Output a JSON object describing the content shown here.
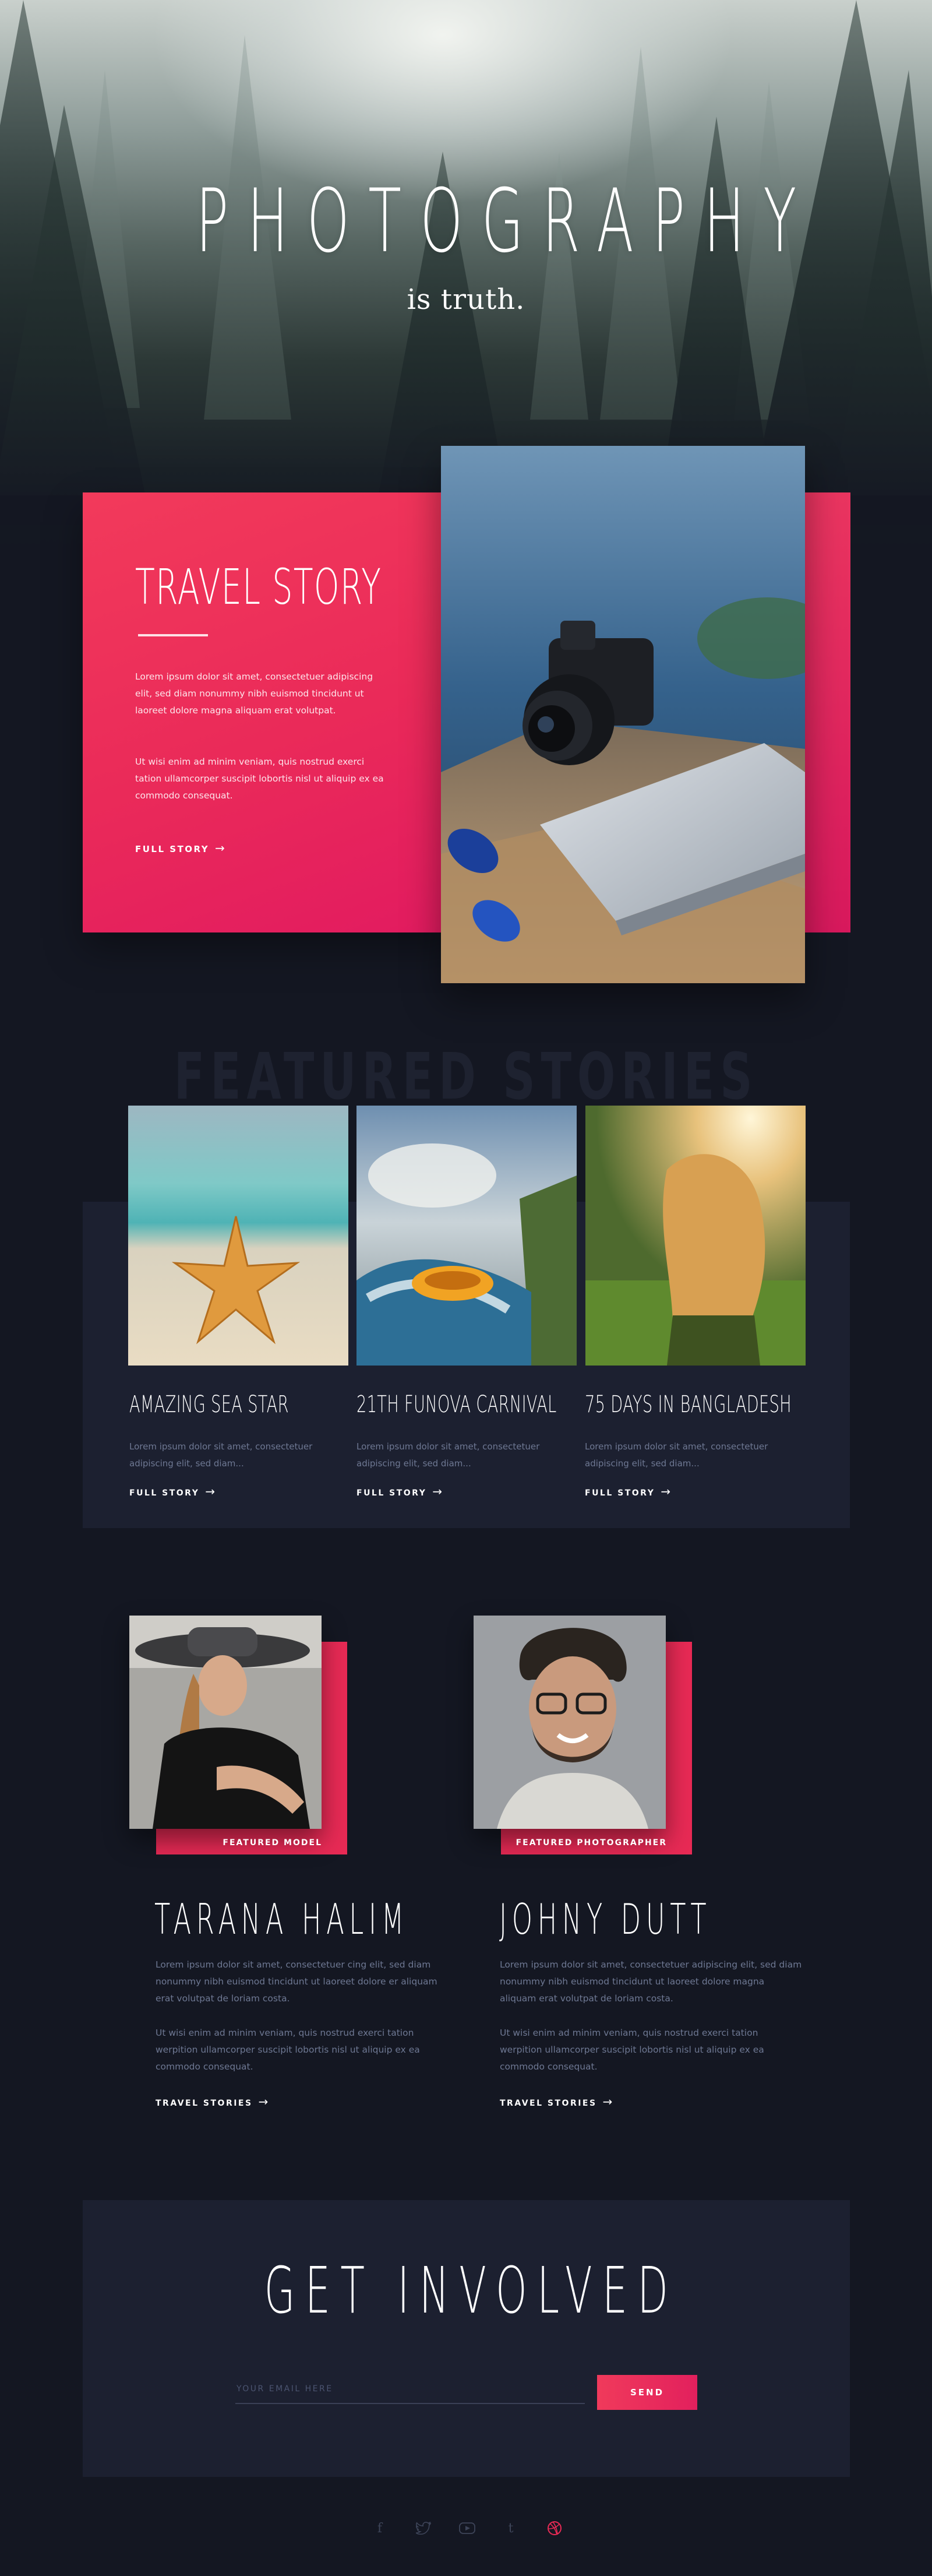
{
  "hero": {
    "title": "PHOTOGRAPHY",
    "subtitle": "is truth."
  },
  "travel": {
    "title": "TRAVEL STORY",
    "para1": "Lorem ipsum dolor sit amet, consectetuer adipiscing elit, sed diam nonummy nibh euismod tincidunt ut laoreet dolore magna aliquam erat volutpat.",
    "para2": "Ut wisi enim ad minim veniam, quis nostrud exerci tation ullamcorper suscipit lobortis nisl ut aliquip ex ea commodo consequat.",
    "link": "FULL STORY",
    "arrow": "→"
  },
  "featured": {
    "heading": "FEATURED STORIES",
    "stories": [
      {
        "title": "AMAZING SEA STAR",
        "desc": "Lorem ipsum dolor sit amet, consectetuer adipiscing elit, sed diam...",
        "link": "FULL STORY"
      },
      {
        "title": "21TH FUNOVA CARNIVAL",
        "desc": "Lorem ipsum dolor sit amet, consectetuer adipiscing elit, sed diam...",
        "link": "FULL STORY"
      },
      {
        "title": "75 DAYS IN BANGLADESH",
        "desc": "Lorem ipsum dolor sit amet, consectetuer adipiscing elit, sed diam...",
        "link": "FULL STORY"
      }
    ]
  },
  "people": [
    {
      "label": "FEATURED MODEL",
      "name": "TARANA HALIM",
      "para1": "Lorem ipsum dolor sit amet, consectetuer cing elit, sed diam nonummy nibh euismod tincidunt ut laoreet dolore er aliquam erat volutpat de loriam costa.",
      "para2": "Ut wisi enim ad minim veniam, quis nostrud exerci tation werpition ullamcorper suscipit lobortis nisl ut aliquip ex ea commodo consequat.",
      "link": "TRAVEL STORIES"
    },
    {
      "label": "FEATURED PHOTOGRAPHER",
      "name": "JOHNY DUTT",
      "para1": "Lorem ipsum dolor sit amet, consectetuer adipiscing elit, sed diam nonummy nibh euismod tincidunt ut laoreet dolore magna aliquam erat volutpat de loriam costa.",
      "para2": "Ut wisi enim ad minim veniam, quis nostrud exerci tation werpition ullamcorper suscipit lobortis nisl ut aliquip ex ea commodo consequat.",
      "link": "TRAVEL STORIES"
    }
  ],
  "involved": {
    "title": "GET INVOLVED",
    "email_placeholder": "YOUR EMAIL HERE",
    "send": "SEND"
  },
  "social": {
    "icons": [
      "facebook-icon",
      "twitter-icon",
      "youtube-icon",
      "tumblr-icon",
      "dribbble-icon"
    ],
    "glyphs": [
      "f",
      "t",
      "▶",
      "t",
      "◎"
    ],
    "active_color": "#e82a55"
  },
  "colors": {
    "accent": "#e82a55",
    "background": "#141722",
    "panel": "#1c2030",
    "muted_text": "#6e7893"
  }
}
